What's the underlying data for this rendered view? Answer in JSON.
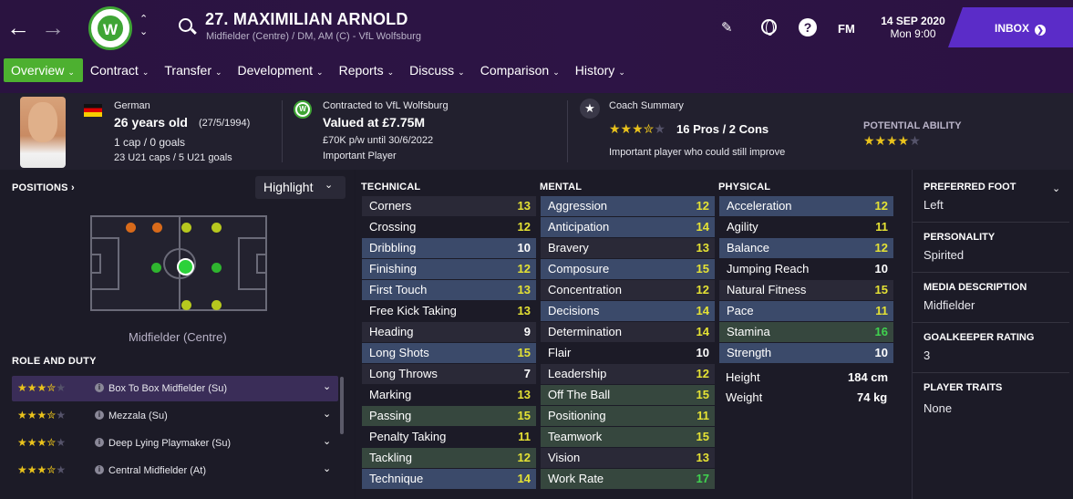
{
  "header": {
    "player_name": "27. MAXIMILIAN ARNOLD",
    "player_sub": "Midfielder (Centre) / DM, AM (C) - VfL Wolfsburg",
    "club_logo_text": "W",
    "fm_label": "FM",
    "date": "14 SEP 2020",
    "time": "Mon 9:00",
    "inbox_label": "INBOX"
  },
  "menu": [
    "Overview",
    "Contract",
    "Transfer",
    "Development",
    "Reports",
    "Discuss",
    "Comparison",
    "History"
  ],
  "summary": {
    "nationality": "German",
    "age": "26 years old",
    "dob": "(27/5/1994)",
    "caps": "1 cap / 0 goals",
    "u21": "23 U21 caps / 5 U21 goals",
    "contract_club": "Contracted to VfL Wolfsburg",
    "value": "Valued at £7.75M",
    "wage": "£70K p/w until 30/6/2022",
    "status": "Important Player",
    "coach_title": "Coach Summary",
    "pros_cons": "16 Pros / 2 Cons",
    "coach_note": "Important player who could still improve",
    "potential_label": "POTENTIAL ABILITY",
    "coach_stars": 3.5,
    "potential_stars": 4
  },
  "positions": {
    "title": "POSITIONS",
    "highlight": "Highlight",
    "position_label": "Midfielder (Centre)"
  },
  "roles": {
    "title": "ROLE AND DUTY",
    "items": [
      {
        "name": "Box To Box Midfielder (Su)",
        "stars": 3.5
      },
      {
        "name": "Mezzala (Su)",
        "stars": 3.5
      },
      {
        "name": "Deep Lying Playmaker (Su)",
        "stars": 3.5
      },
      {
        "name": "Central Midfielder (At)",
        "stars": 3.5
      }
    ]
  },
  "technical": {
    "title": "TECHNICAL",
    "items": [
      {
        "name": "Corners",
        "value": 13
      },
      {
        "name": "Crossing",
        "value": 12
      },
      {
        "name": "Dribbling",
        "value": 10
      },
      {
        "name": "Finishing",
        "value": 12
      },
      {
        "name": "First Touch",
        "value": 13
      },
      {
        "name": "Free Kick Taking",
        "value": 13
      },
      {
        "name": "Heading",
        "value": 9
      },
      {
        "name": "Long Shots",
        "value": 15
      },
      {
        "name": "Long Throws",
        "value": 7
      },
      {
        "name": "Marking",
        "value": 13
      },
      {
        "name": "Passing",
        "value": 15
      },
      {
        "name": "Penalty Taking",
        "value": 11
      },
      {
        "name": "Tackling",
        "value": 12
      },
      {
        "name": "Technique",
        "value": 14
      }
    ]
  },
  "mental": {
    "title": "MENTAL",
    "items": [
      {
        "name": "Aggression",
        "value": 12
      },
      {
        "name": "Anticipation",
        "value": 14
      },
      {
        "name": "Bravery",
        "value": 13
      },
      {
        "name": "Composure",
        "value": 15
      },
      {
        "name": "Concentration",
        "value": 12
      },
      {
        "name": "Decisions",
        "value": 14
      },
      {
        "name": "Determination",
        "value": 14
      },
      {
        "name": "Flair",
        "value": 10
      },
      {
        "name": "Leadership",
        "value": 12
      },
      {
        "name": "Off The Ball",
        "value": 15
      },
      {
        "name": "Positioning",
        "value": 11
      },
      {
        "name": "Teamwork",
        "value": 15
      },
      {
        "name": "Vision",
        "value": 13
      },
      {
        "name": "Work Rate",
        "value": 17
      }
    ]
  },
  "physical": {
    "title": "PHYSICAL",
    "items": [
      {
        "name": "Acceleration",
        "value": 12
      },
      {
        "name": "Agility",
        "value": 11
      },
      {
        "name": "Balance",
        "value": 12
      },
      {
        "name": "Jumping Reach",
        "value": 10
      },
      {
        "name": "Natural Fitness",
        "value": 15
      },
      {
        "name": "Pace",
        "value": 11
      },
      {
        "name": "Stamina",
        "value": 16
      },
      {
        "name": "Strength",
        "value": 10
      }
    ],
    "height_label": "Height",
    "height": "184 cm",
    "weight_label": "Weight",
    "weight": "74 kg"
  },
  "info": {
    "preferred_foot_label": "PREFERRED FOOT",
    "preferred_foot": "Left",
    "personality_label": "PERSONALITY",
    "personality": "Spirited",
    "media_label": "MEDIA DESCRIPTION",
    "media": "Midfielder",
    "gk_label": "GOALKEEPER RATING",
    "gk": "3",
    "traits_label": "PLAYER TRAITS",
    "traits": "None"
  },
  "colors": {
    "header": "#2c1242",
    "accent_green": "#4db030",
    "inbox": "#5b2cc8",
    "highlight_blue": "#3b4a6a",
    "highlight_green": "#36473e"
  }
}
